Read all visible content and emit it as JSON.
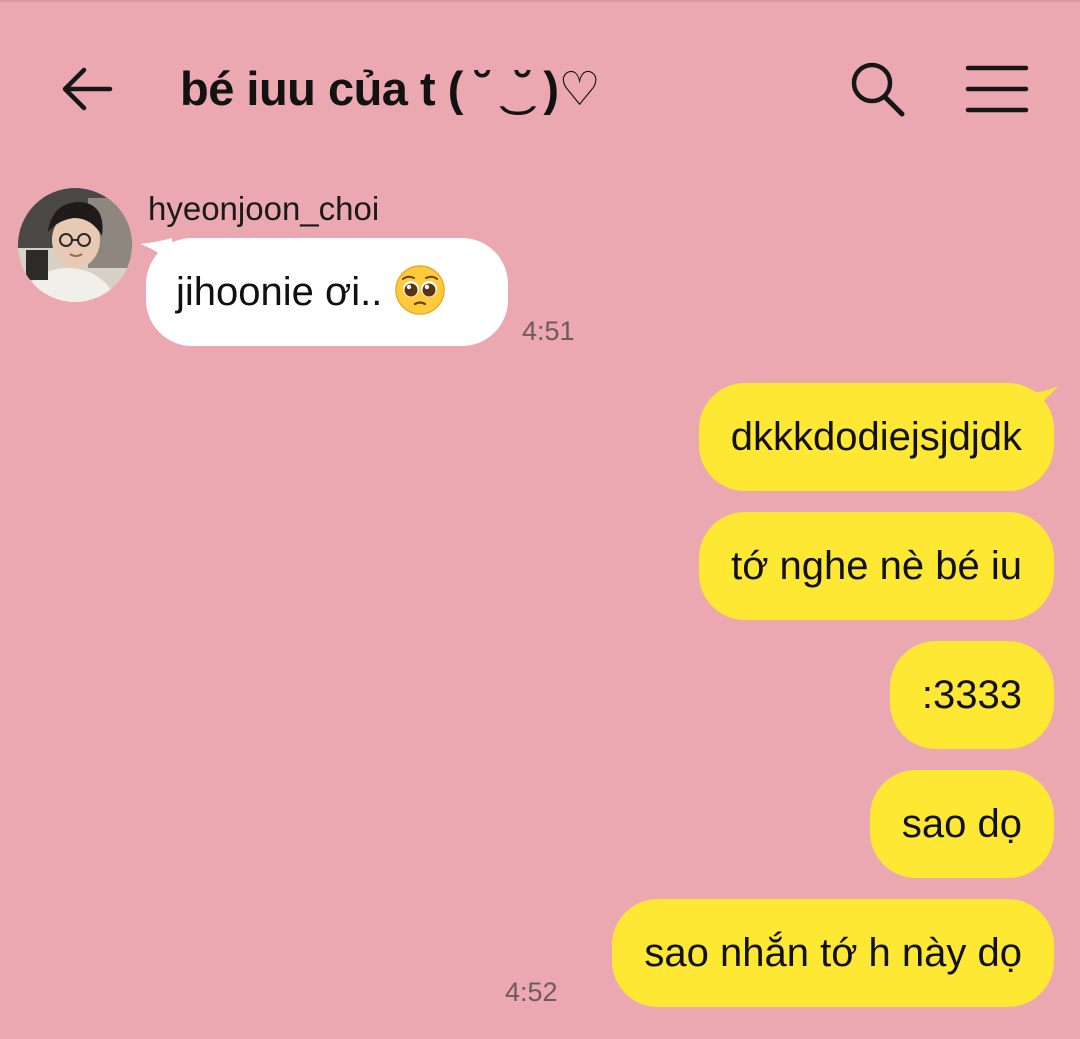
{
  "header": {
    "title": "bé iuu của t ( ˘ ͜ ˘ )♡",
    "back_icon": "arrow-left-icon",
    "search_icon": "search-icon",
    "menu_icon": "hamburger-menu-icon"
  },
  "colors": {
    "background": "#eca8b0",
    "incoming_bubble": "#ffffff",
    "outgoing_bubble": "#ffe833"
  },
  "messages": {
    "incoming": {
      "sender": "hyeonjoon_choi",
      "text": "jihoonie ơi..",
      "emoji": "pleading-face-emoji",
      "time": "4:51"
    },
    "outgoing": [
      {
        "text": "dkkkdodiejsjdjdk"
      },
      {
        "text": "tớ nghe nè bé iu"
      },
      {
        "text": ":3333"
      },
      {
        "text": "sao dọ"
      },
      {
        "text": "sao nhắn tớ h này dọ"
      }
    ],
    "outgoing_time": "4:52"
  }
}
